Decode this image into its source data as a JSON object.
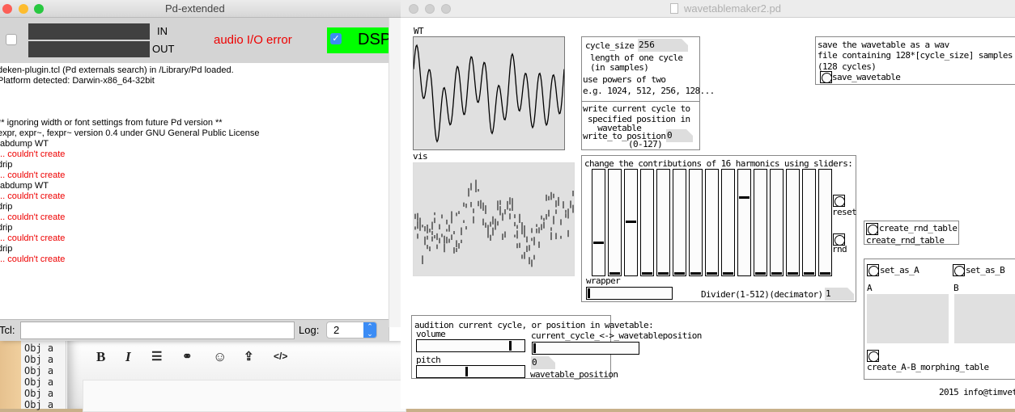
{
  "main_window": {
    "title": "Pd-extended",
    "meter_in_label": "IN",
    "meter_out_label": "OUT",
    "audio_error": "audio I/O error",
    "dsp_label": "DSP",
    "dsp_checked": true,
    "dsp_color": "#00ff00",
    "console_lines": [
      {
        "text": "deken-plugin.tcl (Pd externals search) in /Library/Pd loaded.",
        "error": false
      },
      {
        "text": "Platform detected: Darwin-x86_64-32bit",
        "error": false
      },
      {
        "text": "",
        "error": false
      },
      {
        "text": "",
        "error": false
      },
      {
        "text": "",
        "error": false
      },
      {
        "text": "** ignoring width or font settings from future Pd version **",
        "error": false
      },
      {
        "text": "expr, expr~, fexpr~ version 0.4 under GNU General Public License",
        "error": false
      },
      {
        "text": "tabdump WT",
        "error": false
      },
      {
        "text": "... couldn't create",
        "error": true
      },
      {
        "text": "drip",
        "error": false
      },
      {
        "text": "... couldn't create",
        "error": true
      },
      {
        "text": "tabdump WT",
        "error": false
      },
      {
        "text": "... couldn't create",
        "error": true
      },
      {
        "text": "drip",
        "error": false
      },
      {
        "text": "... couldn't create",
        "error": true
      },
      {
        "text": "drip",
        "error": false
      },
      {
        "text": "... couldn't create",
        "error": true
      },
      {
        "text": "drip",
        "error": false
      },
      {
        "text": "... couldn't create",
        "error": true
      }
    ],
    "tcl_label": "Tcl:",
    "tcl_value": "",
    "log_label": "Log:",
    "log_value": "2"
  },
  "background": {
    "obj_lines": [
      "Obj a",
      "Obj a",
      "Obj a",
      "Obj a",
      "Obj a",
      "Obj a",
      "Obj a"
    ],
    "editor_buttons": [
      "B",
      "I",
      "☰",
      "⚭",
      "☺",
      "⇪",
      "</>"
    ]
  },
  "patch_window": {
    "title": "wavetablemaker2.pd",
    "wt_label": "WT",
    "vis_label": "vis",
    "cycle": {
      "label": "cycle_size",
      "value": "256",
      "desc1": " length of one cycle",
      "desc2": " (in samples)",
      "desc3": "use powers of two",
      "desc4": "e.g. 1024, 512, 256, 128..."
    },
    "write": {
      "desc1": "write current cycle to",
      "desc2": " specified position in",
      "desc3": "   wavetable",
      "label": "write_to_position",
      "value": "0",
      "range": "(0-127)"
    },
    "harmonics": {
      "title": "change the contributions of 16 harmonics using sliders:",
      "slider_values": [
        0.3,
        0,
        0.51,
        0,
        0,
        0,
        0,
        0,
        0,
        0.75,
        0,
        0,
        0,
        0,
        0
      ],
      "reset_label": "reset",
      "rnd_label": "rnd",
      "wrapper_label": "wrapper",
      "wrapper_value": 0,
      "divider_label": "Divider(1-512)(decimator)",
      "divider_value": "1"
    },
    "save": {
      "desc1": "save the wavetable as a wav",
      "desc2": "file containing 128*[cycle_size] samples",
      "desc3": "(128 cycles)",
      "button_label": "save_wavetable"
    },
    "rnd_table": {
      "button_label": "create_rnd_table",
      "caption": "create_rnd_table"
    },
    "ab": {
      "set_a": "set_as_A",
      "set_b": "set_as_B",
      "a_label": "A",
      "b_label": "B",
      "morph_label": "create_A-B_morphing_table"
    },
    "audition": {
      "title": "audition current cycle, or position in wavetable:",
      "volume_label": "volume",
      "volume_value": 0.88,
      "pitch_label": "pitch",
      "pitch_value": 0.46,
      "position_label": "current_cycle_<->_wavetableposition",
      "position_value": 0,
      "wt_pos_label": "wavetable_position",
      "wt_pos_value": "0"
    },
    "footer": "2015 info@timvet"
  }
}
